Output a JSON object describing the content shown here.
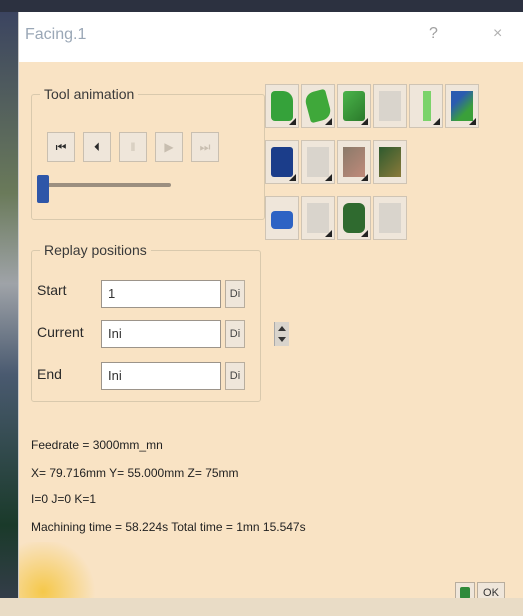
{
  "window": {
    "title": "Facing.1",
    "help_label": "?",
    "close_label": "×"
  },
  "tool_animation": {
    "label": "Tool animation",
    "buttons": [
      {
        "name": "rewind",
        "glyph": "⏮"
      },
      {
        "name": "step-back",
        "glyph": "⏴"
      },
      {
        "name": "pause",
        "glyph": "‖"
      },
      {
        "name": "play",
        "glyph": "▶"
      },
      {
        "name": "forward",
        "glyph": "⏭"
      }
    ],
    "slider_position": 0
  },
  "replay_positions": {
    "label": "Replay positions",
    "start": {
      "label": "Start",
      "value": "1"
    },
    "current": {
      "label": "Current",
      "value": "Ini"
    },
    "end": {
      "label": "End",
      "value": "Ini"
    },
    "pick_label": "Di"
  },
  "tools": {
    "row1": [
      "video-mode-icon",
      "cutter-path-icon",
      "tool-display-icon",
      "report-icon",
      "rod-icon",
      "settings-icon"
    ],
    "row2": [
      "machine-icon",
      "part-icon",
      "stock-icon",
      "analysis-icon"
    ],
    "row3": [
      "photo-mode-icon",
      "blank-icon",
      "clamp-icon",
      "export-icon"
    ]
  },
  "info": {
    "feedrate": "Feedrate = 3000mm_mn",
    "coords": "X= 79.716mm Y= 55.000mm Z= 75mm",
    "ijk": "I=0 J=0 K=1",
    "times": "Machining time = 58.224s   Total time = 1mn 15.547s"
  },
  "footer": {
    "close_label": "OK"
  }
}
